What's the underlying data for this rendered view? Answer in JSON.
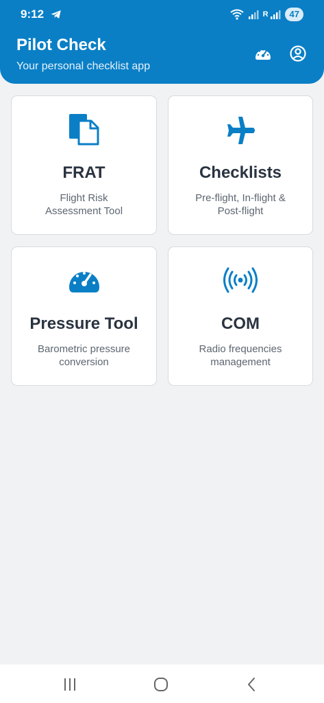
{
  "status_bar": {
    "time": "9:12",
    "battery": "47",
    "network_label": "R"
  },
  "header": {
    "title": "Pilot Check",
    "subtitle": "Your personal checklist app"
  },
  "cards": [
    {
      "title": "FRAT",
      "description": "Flight Risk Assessment Tool",
      "icon": "document-copy-icon"
    },
    {
      "title": "Checklists",
      "description": "Pre-flight, In-flight & Post-flight",
      "icon": "airplane-icon"
    },
    {
      "title": "Pressure Tool",
      "description": "Barometric pressure conversion",
      "icon": "gauge-icon"
    },
    {
      "title": "COM",
      "description": "Radio frequencies management",
      "icon": "radio-waves-icon"
    }
  ],
  "colors": {
    "primary": "#0a7fc6",
    "background": "#f1f2f4",
    "card_title": "#2a3340",
    "card_desc": "#5d6670"
  }
}
